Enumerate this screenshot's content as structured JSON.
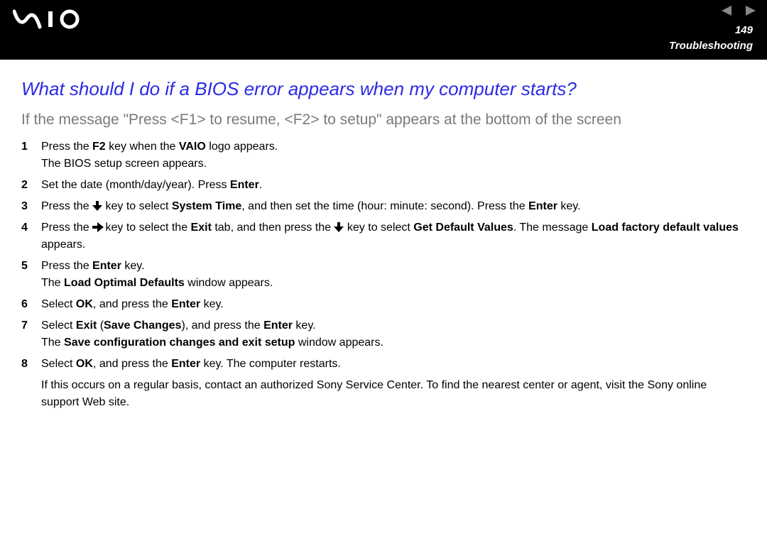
{
  "header": {
    "page_number": "149",
    "section": "Troubleshooting"
  },
  "heading": "What should I do if a BIOS error appears when my computer starts?",
  "subheading": "If the message \"Press <F1> to resume, <F2> to setup\" appears at the bottom of the screen",
  "steps": {
    "s1": {
      "num": "1",
      "a": "Press the ",
      "b": "F2",
      "c": " key when the ",
      "d": "VAIO",
      "e": " logo appears.",
      "f": "The BIOS setup screen appears."
    },
    "s2": {
      "num": "2",
      "a": "Set the date (month/day/year). Press ",
      "b": "Enter",
      "c": "."
    },
    "s3": {
      "num": "3",
      "a": "Press the ",
      "b": " key to select ",
      "c": "System Time",
      "d": ", and then set the time (hour: minute: second). Press the ",
      "e": "Enter",
      "f": " key."
    },
    "s4": {
      "num": "4",
      "a": "Press the ",
      "b": " key to select the ",
      "c": "Exit",
      "d": " tab, and then press the ",
      "e": " key to select ",
      "f": "Get Default Values",
      "g": ". The message ",
      "h": "Load factory default values",
      "i": " appears."
    },
    "s5": {
      "num": "5",
      "a": "Press the ",
      "b": "Enter",
      "c": " key.",
      "d": "The ",
      "e": "Load Optimal Defaults",
      "f": " window appears."
    },
    "s6": {
      "num": "6",
      "a": "Select ",
      "b": "OK",
      "c": ", and press the ",
      "d": "Enter",
      "e": " key."
    },
    "s7": {
      "num": "7",
      "a": "Select ",
      "b": "Exit",
      "c": " (",
      "d": "Save Changes",
      "e": "), and press the ",
      "f": "Enter",
      "g": " key.",
      "h": "The ",
      "i": "Save configuration changes and exit setup",
      "j": " window appears."
    },
    "s8": {
      "num": "8",
      "a": "Select ",
      "b": "OK",
      "c": ", and press the ",
      "d": "Enter",
      "e": " key. The computer restarts."
    }
  },
  "footnote": "If this occurs on a regular basis, contact an authorized Sony Service Center. To find the nearest center or agent, visit the Sony online support Web site."
}
